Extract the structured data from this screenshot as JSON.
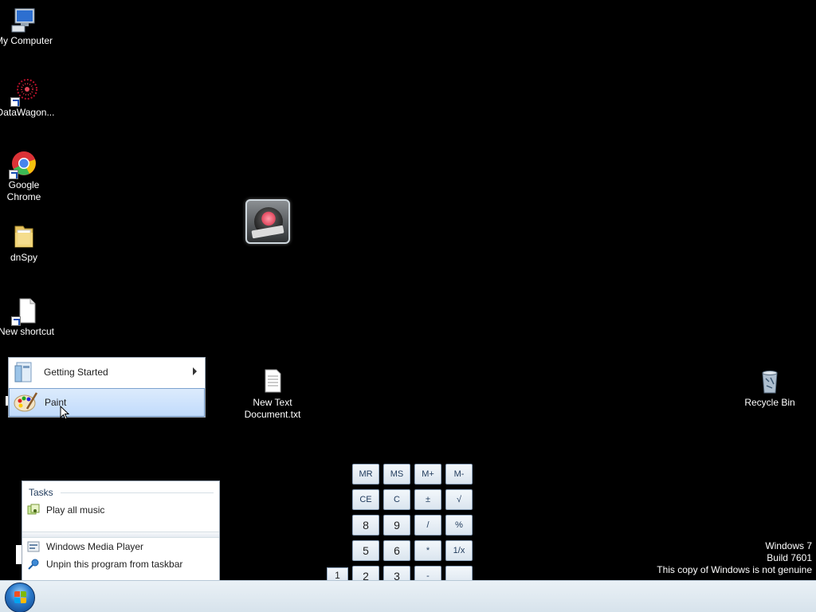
{
  "desktop_icons": [
    {
      "label": "My Computer"
    },
    {
      "label": "DataWagon..."
    },
    {
      "label": "Google Chrome"
    },
    {
      "label": "dnSpy"
    },
    {
      "label": "New shortcut"
    },
    {
      "label": "New Text Document.txt"
    },
    {
      "label": "Recycle Bin"
    }
  ],
  "start_menu": {
    "items": [
      {
        "label": "Getting Started",
        "has_submenu": true
      },
      {
        "label": "Paint",
        "selected": true
      }
    ]
  },
  "jump_list": {
    "tasks_title": "Tasks",
    "tasks": [
      {
        "label": "Play all music"
      }
    ],
    "pinned": [
      {
        "label": "Windows Media Player"
      },
      {
        "label": "Unpin this program from taskbar"
      }
    ]
  },
  "calculator": {
    "buttons": [
      "MR",
      "MS",
      "M+",
      "M-",
      "CE",
      "C",
      "±",
      "√",
      "8",
      "9",
      "/",
      "%",
      "5",
      "6",
      "*",
      "1/x",
      "2",
      "3",
      "-",
      "",
      "1"
    ]
  },
  "watermark": {
    "line1": "Windows 7",
    "line2": "Build 7601",
    "line3": "This copy of Windows is not genuine"
  },
  "colors": {
    "desktop_bg": "#000000",
    "selection": "#c1dbfc",
    "taskbar": "#dfe9f1"
  }
}
